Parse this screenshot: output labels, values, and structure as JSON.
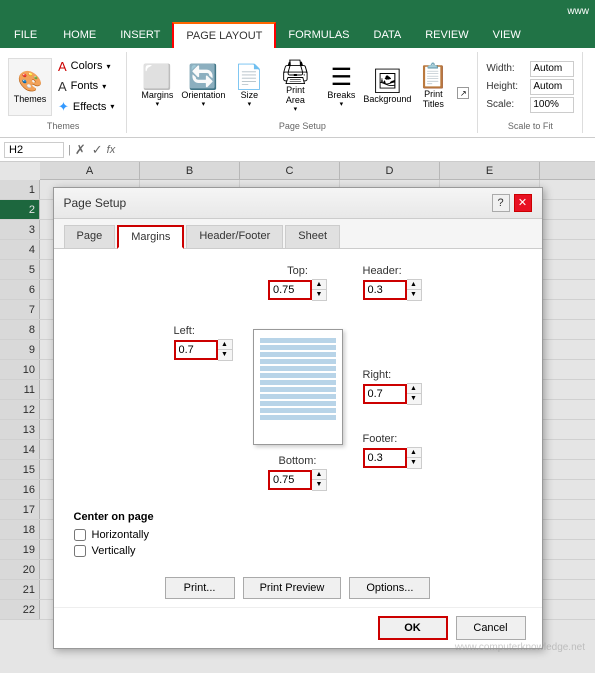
{
  "titlebar": {
    "url": "www"
  },
  "ribbon": {
    "tabs": [
      "FILE",
      "HOME",
      "INSERT",
      "PAGE LAYOUT",
      "FORMULAS",
      "DATA",
      "REVIEW",
      "VIEW"
    ],
    "active_tab": "PAGE LAYOUT",
    "groups": {
      "themes": {
        "label": "Themes",
        "button_label": "Themes"
      },
      "themeOptions": {
        "colors": "Colors",
        "fonts": "Fonts",
        "effects": "Effects"
      },
      "pageSetup": {
        "label": "Page Setup",
        "margins": "Margins",
        "orientation": "Orientation",
        "size": "Size",
        "print_area": "Print\nArea",
        "breaks": "Breaks",
        "background": "Background",
        "print_titles": "Print\nTitles"
      },
      "scaleToFit": {
        "label": "Scale to Fit",
        "width_label": "Width:",
        "width_val": "Autom",
        "height_label": "Height:",
        "height_val": "Autom",
        "scale_label": "Scale:",
        "scale_val": "100%"
      }
    }
  },
  "formulaBar": {
    "cellRef": "H2",
    "fx": "fx",
    "cancelIcon": "✗",
    "confirmIcon": "✓"
  },
  "spreadsheet": {
    "columns": [
      "A",
      "B",
      "C",
      "D",
      "E"
    ],
    "rows": [
      1,
      2,
      3,
      4,
      5,
      6,
      7,
      8,
      9,
      10,
      11,
      12,
      13,
      14,
      15,
      16,
      17,
      18,
      19,
      20,
      21,
      22
    ]
  },
  "dialog": {
    "title": "Page Setup",
    "tabs": [
      "Page",
      "Margins",
      "Header/Footer",
      "Sheet"
    ],
    "active_tab": "Margins",
    "margins": {
      "top_label": "Top:",
      "top_val": "0.75",
      "bottom_label": "Bottom:",
      "bottom_val": "0.75",
      "left_label": "Left:",
      "left_val": "0.7",
      "right_label": "Right:",
      "right_val": "0.7",
      "header_label": "Header:",
      "header_val": "0.3",
      "footer_label": "Footer:",
      "footer_val": "0.3"
    },
    "centerOnPage": {
      "title": "Center on page",
      "horizontally": "Horizontally",
      "vertically": "Vertically"
    },
    "buttons": {
      "print": "Print...",
      "printPreview": "Print Preview",
      "options": "Options...",
      "ok": "OK",
      "cancel": "Cancel"
    },
    "watermark": "www.computerknowledge.net"
  }
}
